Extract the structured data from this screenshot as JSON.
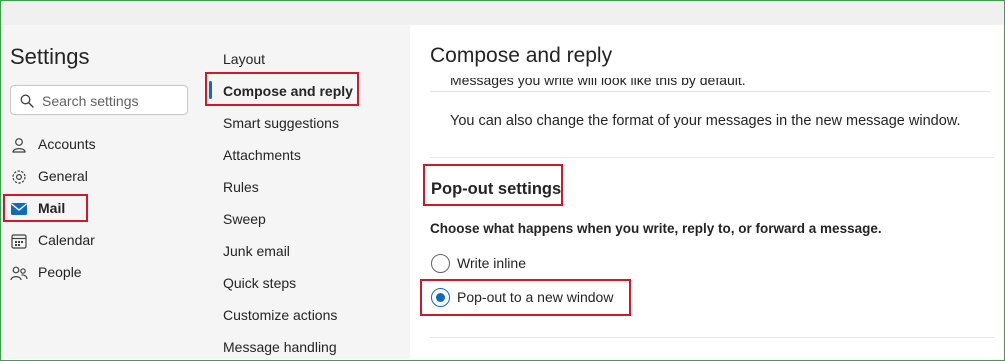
{
  "settings": {
    "title": "Settings",
    "search_placeholder": "Search settings",
    "nav": [
      {
        "label": "Accounts",
        "icon": "person-icon"
      },
      {
        "label": "General",
        "icon": "gear-icon"
      },
      {
        "label": "Mail",
        "icon": "mail-icon",
        "selected": true
      },
      {
        "label": "Calendar",
        "icon": "calendar-icon"
      },
      {
        "label": "People",
        "icon": "people-icon"
      }
    ]
  },
  "mail_menu": {
    "items": [
      {
        "label": "Layout"
      },
      {
        "label": "Compose and reply",
        "selected": true
      },
      {
        "label": "Smart suggestions"
      },
      {
        "label": "Attachments"
      },
      {
        "label": "Rules"
      },
      {
        "label": "Sweep"
      },
      {
        "label": "Junk email"
      },
      {
        "label": "Quick steps"
      },
      {
        "label": "Customize actions"
      },
      {
        "label": "Message handling"
      }
    ]
  },
  "content": {
    "heading": "Compose and reply",
    "partial_text": "Messages you write will look like this by default.",
    "format_text": "You can also change the format of your messages in the new message window.",
    "popout": {
      "heading": "Pop-out settings",
      "description": "Choose what happens when you write, reply to, or forward a message.",
      "options": [
        {
          "label": "Write inline",
          "checked": false
        },
        {
          "label": "Pop-out to a new window",
          "checked": true
        }
      ]
    }
  },
  "colors": {
    "accent": "#0f6cbd",
    "highlight_box": "#d1182a",
    "frame_border": "#3aa04a"
  }
}
